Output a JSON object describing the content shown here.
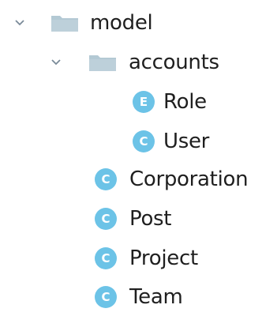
{
  "colors": {
    "class_badge": "#6cc3e7",
    "folder": "#b3c9d4",
    "chevron": "#7a8a99",
    "text": "#1f1f1f"
  },
  "tree": {
    "model": {
      "label": "model",
      "icon": "folder-icon",
      "expanded": true
    },
    "accounts": {
      "label": "accounts",
      "icon": "folder-icon",
      "expanded": true
    },
    "role": {
      "label": "Role",
      "badge": "E",
      "icon": "enum-icon"
    },
    "user": {
      "label": "User",
      "badge": "C",
      "icon": "class-icon"
    },
    "corporation": {
      "label": "Corporation",
      "badge": "C",
      "icon": "class-icon"
    },
    "post": {
      "label": "Post",
      "badge": "C",
      "icon": "class-icon"
    },
    "project": {
      "label": "Project",
      "badge": "C",
      "icon": "class-icon"
    },
    "team": {
      "label": "Team",
      "badge": "C",
      "icon": "class-icon"
    }
  }
}
